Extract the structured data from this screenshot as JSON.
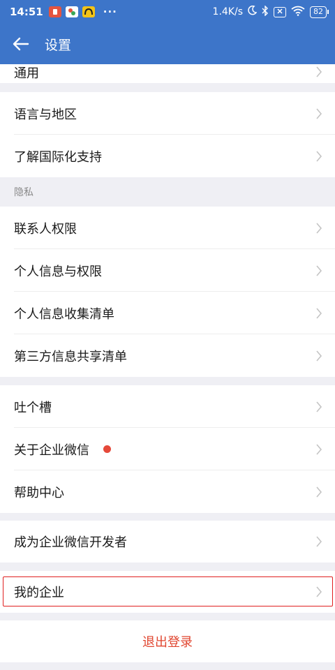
{
  "status_bar": {
    "time": "14:51",
    "dots": "···",
    "net_speed": "1.4K/s",
    "battery": "82"
  },
  "header": {
    "title": "设置"
  },
  "groups": {
    "general": {
      "partial_label": "通用"
    },
    "i18n": {
      "items": [
        {
          "label": "语言与地区"
        },
        {
          "label": "了解国际化支持"
        }
      ]
    },
    "privacy": {
      "header": "隐私",
      "items": [
        {
          "label": "联系人权限"
        },
        {
          "label": "个人信息与权限"
        },
        {
          "label": "个人信息收集清单"
        },
        {
          "label": "第三方信息共享清单"
        }
      ]
    },
    "support": {
      "items": [
        {
          "label": "吐个槽"
        },
        {
          "label": "关于企业微信"
        },
        {
          "label": "帮助中心"
        }
      ]
    },
    "developer": {
      "label": "成为企业微信开发者"
    },
    "enterprise": {
      "label": "我的企业"
    }
  },
  "logout": {
    "label": "退出登录"
  },
  "colors": {
    "header_bg": "#3d75c9",
    "page_bg": "#efeff4",
    "logout_text": "#e0452f",
    "badge_dot": "#e5493a",
    "highlight_border": "#e02020"
  }
}
